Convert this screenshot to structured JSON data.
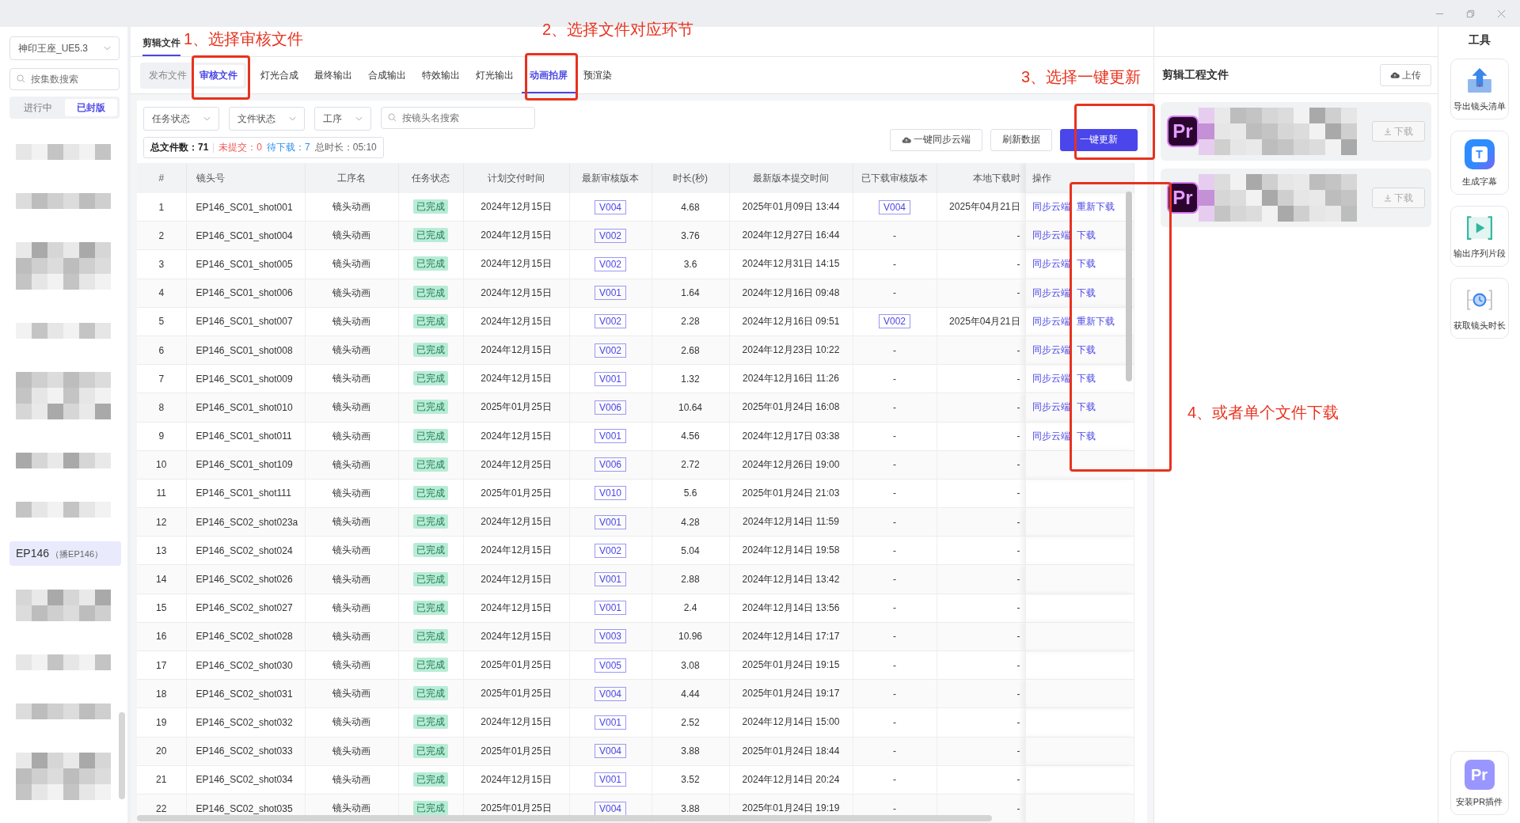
{
  "sidebar": {
    "project": "神印王座_UE5.3",
    "search": {
      "placeholder": "按集数搜索"
    },
    "segments": [
      {
        "label": "进行中",
        "selected": false
      },
      {
        "label": "已封版",
        "selected": true
      }
    ],
    "items": [
      {
        "kind": "picture"
      },
      {
        "kind": "picture"
      },
      {
        "kind": "picture"
      },
      {
        "kind": "picture"
      },
      {
        "kind": "picture"
      },
      {
        "kind": "picture"
      },
      {
        "kind": "picture"
      },
      {
        "kind": "episode",
        "label": "EP146",
        "note": "（播EP146）",
        "selected": true
      },
      {
        "kind": "picture"
      },
      {
        "kind": "picture"
      },
      {
        "kind": "picture"
      },
      {
        "kind": "picture"
      }
    ]
  },
  "main_tabs": [
    {
      "label": "剪辑文件",
      "selected": true
    }
  ],
  "file_types": [
    {
      "label": "发布文件",
      "selected": false
    },
    {
      "label": "审核文件",
      "selected": true
    }
  ],
  "stages": [
    {
      "label": "灯光合成",
      "selected": false
    },
    {
      "label": "最终输出",
      "selected": false
    },
    {
      "label": "合成输出",
      "selected": false
    },
    {
      "label": "特效输出",
      "selected": false
    },
    {
      "label": "灯光输出",
      "selected": false
    },
    {
      "label": "动画拍屏",
      "selected": true
    },
    {
      "label": "预渲染",
      "selected": false
    }
  ],
  "filters": [
    "任务状态",
    "文件状态",
    "工序"
  ],
  "search": {
    "placeholder": "按镜头名搜索"
  },
  "buttons": [
    {
      "kind": "cloud",
      "label": "一键同步云端"
    },
    {
      "kind": "plain",
      "label": "刷新数据"
    },
    {
      "kind": "primary",
      "label": "一键更新"
    }
  ],
  "summary": {
    "total_label": "总文件数：",
    "total": "71",
    "unsubmitted_label": "未提交：",
    "unsubmitted": "0",
    "pending_label": "待下载：",
    "pending": "7",
    "duration_label": "总时长：",
    "duration": "05:10"
  },
  "table": {
    "columns": [
      "#",
      "镜头号",
      "工序名",
      "任务状态",
      "计划交付时间",
      "最新审核版本",
      "时长(秒)",
      "最新版本提交时间",
      "已下载审核版本",
      "本地下载时",
      "操作"
    ],
    "rows": [
      {
        "no": "1",
        "shot": "EP146_SC01_shot001",
        "process": "镜头动画",
        "status": "已完成",
        "planned": "2024年12月15日",
        "version": "V004",
        "duration": "4.68",
        "submitted": "2025年01月09日 13:44",
        "downloaded": {
          "kind": "tag",
          "text": "V004"
        },
        "local_time": "2025年04月21日",
        "actions": [
          "同步云端",
          "重新下载"
        ]
      },
      {
        "no": "2",
        "shot": "EP146_SC01_shot004",
        "process": "镜头动画",
        "status": "已完成",
        "planned": "2024年12月15日",
        "version": "V002",
        "duration": "3.76",
        "submitted": "2024年12月27日 16:44",
        "downloaded": {
          "kind": "plain",
          "text": "-"
        },
        "local_time": "-",
        "actions": [
          "同步云端",
          "下载"
        ]
      },
      {
        "no": "3",
        "shot": "EP146_SC01_shot005",
        "process": "镜头动画",
        "status": "已完成",
        "planned": "2024年12月15日",
        "version": "V002",
        "duration": "3.6",
        "submitted": "2024年12月31日 14:15",
        "downloaded": {
          "kind": "plain",
          "text": "-"
        },
        "local_time": "-",
        "actions": [
          "同步云端",
          "下载"
        ]
      },
      {
        "no": "4",
        "shot": "EP146_SC01_shot006",
        "process": "镜头动画",
        "status": "已完成",
        "planned": "2024年12月15日",
        "version": "V001",
        "duration": "1.64",
        "submitted": "2024年12月16日 09:48",
        "downloaded": {
          "kind": "plain",
          "text": "-"
        },
        "local_time": "-",
        "actions": [
          "同步云端",
          "下载"
        ]
      },
      {
        "no": "5",
        "shot": "EP146_SC01_shot007",
        "process": "镜头动画",
        "status": "已完成",
        "planned": "2024年12月15日",
        "version": "V002",
        "duration": "2.28",
        "submitted": "2024年12月16日 09:51",
        "downloaded": {
          "kind": "tag",
          "text": "V002"
        },
        "local_time": "2025年04月21日",
        "actions": [
          "同步云端",
          "重新下载"
        ]
      },
      {
        "no": "6",
        "shot": "EP146_SC01_shot008",
        "process": "镜头动画",
        "status": "已完成",
        "planned": "2024年12月15日",
        "version": "V002",
        "duration": "2.68",
        "submitted": "2024年12月23日 10:22",
        "downloaded": {
          "kind": "plain",
          "text": "-"
        },
        "local_time": "-",
        "actions": [
          "同步云端",
          "下载"
        ]
      },
      {
        "no": "7",
        "shot": "EP146_SC01_shot009",
        "process": "镜头动画",
        "status": "已完成",
        "planned": "2024年12月15日",
        "version": "V001",
        "duration": "1.32",
        "submitted": "2024年12月16日 11:26",
        "downloaded": {
          "kind": "plain",
          "text": "-"
        },
        "local_time": "-",
        "actions": [
          "同步云端",
          "下载"
        ]
      },
      {
        "no": "8",
        "shot": "EP146_SC01_shot010",
        "process": "镜头动画",
        "status": "已完成",
        "planned": "2025年01月25日",
        "version": "V006",
        "duration": "10.64",
        "submitted": "2025年01月24日 16:08",
        "downloaded": {
          "kind": "plain",
          "text": "-"
        },
        "local_time": "-",
        "actions": [
          "同步云端",
          "下载"
        ]
      },
      {
        "no": "9",
        "shot": "EP146_SC01_shot011",
        "process": "镜头动画",
        "status": "已完成",
        "planned": "2024年12月15日",
        "version": "V001",
        "duration": "4.56",
        "submitted": "2024年12月17日 03:38",
        "downloaded": {
          "kind": "plain",
          "text": "-"
        },
        "local_time": "-",
        "actions": [
          "同步云端",
          "下载"
        ]
      },
      {
        "no": "10",
        "shot": "EP146_SC01_shot109",
        "process": "镜头动画",
        "status": "已完成",
        "planned": "2024年12月25日",
        "version": "V006",
        "duration": "2.72",
        "submitted": "2024年12月26日 19:00",
        "downloaded": {
          "kind": "plain",
          "text": "-"
        },
        "local_time": "-"
      },
      {
        "no": "11",
        "shot": "EP146_SC01_shot111",
        "process": "镜头动画",
        "status": "已完成",
        "planned": "2025年01月25日",
        "version": "V010",
        "duration": "5.6",
        "submitted": "2025年01月24日 21:03",
        "downloaded": {
          "kind": "plain",
          "text": "-"
        },
        "local_time": "-"
      },
      {
        "no": "12",
        "shot": "EP146_SC02_shot023a",
        "process": "镜头动画",
        "status": "已完成",
        "planned": "2024年12月15日",
        "version": "V001",
        "duration": "4.28",
        "submitted": "2024年12月14日 11:59",
        "downloaded": {
          "kind": "plain",
          "text": "-"
        },
        "local_time": "-"
      },
      {
        "no": "13",
        "shot": "EP146_SC02_shot024",
        "process": "镜头动画",
        "status": "已完成",
        "planned": "2024年12月15日",
        "version": "V002",
        "duration": "5.04",
        "submitted": "2024年12月14日 19:58",
        "downloaded": {
          "kind": "plain",
          "text": "-"
        },
        "local_time": "-"
      },
      {
        "no": "14",
        "shot": "EP146_SC02_shot026",
        "process": "镜头动画",
        "status": "已完成",
        "planned": "2024年12月15日",
        "version": "V001",
        "duration": "2.88",
        "submitted": "2024年12月14日 13:42",
        "downloaded": {
          "kind": "plain",
          "text": "-"
        },
        "local_time": "-"
      },
      {
        "no": "15",
        "shot": "EP146_SC02_shot027",
        "process": "镜头动画",
        "status": "已完成",
        "planned": "2024年12月15日",
        "version": "V001",
        "duration": "2.4",
        "submitted": "2024年12月14日 13:56",
        "downloaded": {
          "kind": "plain",
          "text": "-"
        },
        "local_time": "-"
      },
      {
        "no": "16",
        "shot": "EP146_SC02_shot028",
        "process": "镜头动画",
        "status": "已完成",
        "planned": "2024年12月15日",
        "version": "V003",
        "duration": "10.96",
        "submitted": "2024年12月14日 17:17",
        "downloaded": {
          "kind": "plain",
          "text": "-"
        },
        "local_time": "-"
      },
      {
        "no": "17",
        "shot": "EP146_SC02_shot030",
        "process": "镜头动画",
        "status": "已完成",
        "planned": "2025年01月25日",
        "version": "V005",
        "duration": "3.08",
        "submitted": "2025年01月24日 19:15",
        "downloaded": {
          "kind": "plain",
          "text": "-"
        },
        "local_time": "-"
      },
      {
        "no": "18",
        "shot": "EP146_SC02_shot031",
        "process": "镜头动画",
        "status": "已完成",
        "planned": "2025年01月25日",
        "version": "V004",
        "duration": "4.44",
        "submitted": "2025年01月24日 19:17",
        "downloaded": {
          "kind": "plain",
          "text": "-"
        },
        "local_time": "-"
      },
      {
        "no": "19",
        "shot": "EP146_SC02_shot032",
        "process": "镜头动画",
        "status": "已完成",
        "planned": "2024年12月15日",
        "version": "V001",
        "duration": "2.52",
        "submitted": "2024年12月14日 15:00",
        "downloaded": {
          "kind": "plain",
          "text": "-"
        },
        "local_time": "-"
      },
      {
        "no": "20",
        "shot": "EP146_SC02_shot033",
        "process": "镜头动画",
        "status": "已完成",
        "planned": "2025年01月25日",
        "version": "V004",
        "duration": "3.88",
        "submitted": "2025年01月24日 18:44",
        "downloaded": {
          "kind": "plain",
          "text": "-"
        },
        "local_time": "-"
      },
      {
        "no": "21",
        "shot": "EP146_SC02_shot034",
        "process": "镜头动画",
        "status": "已完成",
        "planned": "2024年12月15日",
        "version": "V001",
        "duration": "3.52",
        "submitted": "2024年12月14日 20:24",
        "downloaded": {
          "kind": "plain",
          "text": "-"
        },
        "local_time": "-"
      },
      {
        "no": "22",
        "shot": "EP146_SC02_shot035",
        "process": "镜头动画",
        "status": "已完成",
        "planned": "2025年01月25日",
        "version": "V004",
        "duration": "3.88",
        "submitted": "2025年01月24日 19:19",
        "downloaded": {
          "kind": "plain",
          "text": "-"
        },
        "local_time": "-"
      }
    ]
  },
  "project_files": {
    "title": "剪辑工程文件",
    "upload": "上传",
    "files": [
      {
        "icon_text": "Pr",
        "download": "下载",
        "disabled": true
      },
      {
        "icon_text": "Pr",
        "download": "下载",
        "disabled": true
      }
    ]
  },
  "tools": {
    "title": "工具",
    "items": [
      {
        "kind": "export",
        "label": "导出镜头清单"
      },
      {
        "kind": "subtitle",
        "label": "生成字幕",
        "icon_text": "T"
      },
      {
        "kind": "sequence",
        "label": "输出序列片段"
      },
      {
        "kind": "duration",
        "label": "获取镜头时长"
      },
      {
        "kind": "plugin",
        "label": "安装PR插件",
        "icon_text": "Pr"
      }
    ]
  },
  "annotations": [
    "1、选择审核文件",
    "2、选择文件对应环节",
    "3、选择一键更新",
    "4、或者单个文件下载"
  ]
}
